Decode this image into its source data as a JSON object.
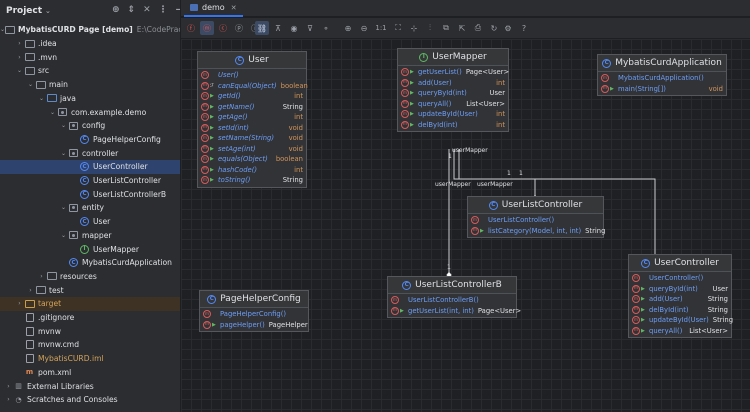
{
  "project_pane": {
    "title": "Project",
    "tree": [
      {
        "label": "MybatisCURD Page [demo]",
        "suffix": "E:\\CodePractic",
        "icon": "folder-icon",
        "expanded": true,
        "indent": 0,
        "bold": true
      },
      {
        "label": ".idea",
        "icon": "folder-icon",
        "expanded": false,
        "indent": 1
      },
      {
        "label": ".mvn",
        "icon": "folder-icon",
        "expanded": false,
        "indent": 1
      },
      {
        "label": "src",
        "icon": "folder-icon",
        "expanded": true,
        "indent": 1
      },
      {
        "label": "main",
        "icon": "folder-icon",
        "expanded": true,
        "indent": 2
      },
      {
        "label": "java",
        "icon": "source-folder-icon",
        "expanded": true,
        "indent": 3
      },
      {
        "label": "com.example.demo",
        "icon": "package-icon",
        "expanded": true,
        "indent": 4
      },
      {
        "label": "config",
        "icon": "package-icon",
        "expanded": true,
        "indent": 5
      },
      {
        "label": "PageHelperConfig",
        "icon": "class-icon",
        "indent": 6
      },
      {
        "label": "controller",
        "icon": "package-icon",
        "expanded": true,
        "indent": 5
      },
      {
        "label": "UserController",
        "icon": "class-icon",
        "indent": 6,
        "selected": true
      },
      {
        "label": "UserListController",
        "icon": "class-icon",
        "indent": 6
      },
      {
        "label": "UserListControllerB",
        "icon": "class-icon",
        "indent": 6
      },
      {
        "label": "entity",
        "icon": "package-icon",
        "expanded": true,
        "indent": 5
      },
      {
        "label": "User",
        "icon": "class-icon",
        "indent": 6
      },
      {
        "label": "mapper",
        "icon": "package-icon",
        "expanded": true,
        "indent": 5
      },
      {
        "label": "UserMapper",
        "icon": "interface-icon",
        "indent": 6
      },
      {
        "label": "MybatisCurdApplication",
        "icon": "class-icon",
        "indent": 5
      },
      {
        "label": "resources",
        "icon": "folder-icon",
        "expanded": false,
        "indent": 3
      },
      {
        "label": "test",
        "icon": "folder-icon",
        "expanded": false,
        "indent": 2
      },
      {
        "label": "target",
        "icon": "folder-icon",
        "expanded": false,
        "indent": 1,
        "highlight": true,
        "color": "orange"
      },
      {
        "label": ".gitignore",
        "icon": "file-icon",
        "indent": 1
      },
      {
        "label": "mvnw",
        "icon": "file-icon",
        "indent": 1
      },
      {
        "label": "mvnw.cmd",
        "icon": "file-icon",
        "indent": 1
      },
      {
        "label": "MybatisCURD.iml",
        "icon": "file-icon",
        "indent": 1,
        "color": "orange"
      },
      {
        "label": "pom.xml",
        "icon": "maven-icon",
        "indent": 1
      },
      {
        "label": "External Libraries",
        "icon": "library-icon",
        "expanded": false,
        "indent": 0
      },
      {
        "label": "Scratches and Consoles",
        "icon": "scratch-icon",
        "expanded": false,
        "indent": 0
      }
    ]
  },
  "editor_tab": {
    "label": "demo"
  },
  "toolbar": {
    "zoom_actual": "1:1"
  },
  "diagram": {
    "nodes": [
      {
        "id": "user",
        "title": "User",
        "kind": "class",
        "members": [
          {
            "name": "User()",
            "type": "",
            "italic": true,
            "vis": ""
          },
          {
            "name": "canEqual(Object)",
            "type": "boolean",
            "italic": true,
            "vis": "f",
            "type_color": "orange"
          },
          {
            "name": "getId()",
            "type": "int",
            "italic": true,
            "vis": "p",
            "type_color": "orange"
          },
          {
            "name": "getName()",
            "type": "String",
            "italic": true,
            "vis": "p"
          },
          {
            "name": "getAge()",
            "type": "int",
            "italic": true,
            "vis": "p",
            "type_color": "orange"
          },
          {
            "name": "setId(int)",
            "type": "void",
            "italic": true,
            "vis": "p",
            "type_color": "orange"
          },
          {
            "name": "setName(String)",
            "type": "void",
            "italic": true,
            "vis": "p",
            "type_color": "orange"
          },
          {
            "name": "setAge(int)",
            "type": "void",
            "italic": true,
            "vis": "p",
            "type_color": "orange"
          },
          {
            "name": "equals(Object)",
            "type": "boolean",
            "italic": true,
            "vis": "p",
            "type_color": "orange"
          },
          {
            "name": "hashCode()",
            "type": "int",
            "italic": true,
            "vis": "p",
            "type_color": "orange"
          },
          {
            "name": "toString()",
            "type": "String",
            "italic": true,
            "vis": "p"
          }
        ]
      },
      {
        "id": "usermapper",
        "title": "UserMapper",
        "kind": "interface",
        "members": [
          {
            "name": "getUserList()",
            "type": "Page<User>",
            "vis": "p"
          },
          {
            "name": "add(User)",
            "type": "int",
            "vis": "p",
            "type_color": "orange"
          },
          {
            "name": "queryById(int)",
            "type": "User",
            "vis": "p"
          },
          {
            "name": "queryAll()",
            "type": "List<User>",
            "vis": "p"
          },
          {
            "name": "updateById(User)",
            "type": "int",
            "vis": "p",
            "type_color": "orange"
          },
          {
            "name": "delById(int)",
            "type": "int",
            "vis": "p",
            "type_color": "orange"
          }
        ]
      },
      {
        "id": "app",
        "title": "MybatisCurdApplication",
        "kind": "class",
        "members": [
          {
            "name": "MybatisCurdApplication()",
            "type": "",
            "vis": ""
          },
          {
            "name": "main(String[])",
            "type": "void",
            "vis": "p",
            "type_color": "orange"
          }
        ]
      },
      {
        "id": "ulc",
        "title": "UserListController",
        "kind": "class",
        "members": [
          {
            "name": "UserListController()",
            "type": "",
            "vis": ""
          },
          {
            "name": "listCategory(Model, int, int)",
            "type": "String",
            "vis": "p"
          }
        ]
      },
      {
        "id": "phc",
        "title": "PageHelperConfig",
        "kind": "class",
        "members": [
          {
            "name": "PageHelperConfig()",
            "type": "",
            "vis": ""
          },
          {
            "name": "pageHelper()",
            "type": "PageHelper",
            "vis": "p"
          }
        ]
      },
      {
        "id": "ulcb",
        "title": "UserListControllerB",
        "kind": "class",
        "members": [
          {
            "name": "UserListControllerB()",
            "type": "",
            "vis": ""
          },
          {
            "name": "getUserList(int, int)",
            "type": "Page<User>",
            "vis": "p"
          }
        ]
      },
      {
        "id": "uc",
        "title": "UserController",
        "kind": "class",
        "members": [
          {
            "name": "UserController()",
            "type": "",
            "vis": ""
          },
          {
            "name": "queryById(int)",
            "type": "User",
            "vis": "p"
          },
          {
            "name": "add(User)",
            "type": "String",
            "vis": "p"
          },
          {
            "name": "delById(int)",
            "type": "String",
            "vis": "p"
          },
          {
            "name": "updateById(User)",
            "type": "String",
            "vis": "p"
          },
          {
            "name": "queryAll()",
            "type": "List<User>",
            "vis": "p"
          }
        ]
      }
    ],
    "edge_labels": [
      "userMapper",
      "1",
      "1",
      "1",
      "userMapper",
      "userMapper",
      "1"
    ]
  }
}
